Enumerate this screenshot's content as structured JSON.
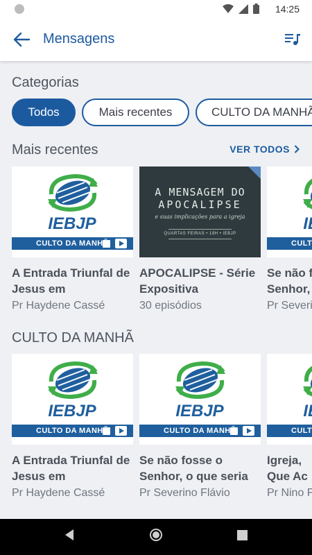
{
  "status_bar": {
    "time": "14:25"
  },
  "app_bar": {
    "title": "Mensagens"
  },
  "categories": {
    "title": "Categorias",
    "chips": [
      {
        "label": "Todos",
        "active": true
      },
      {
        "label": "Mais recentes",
        "active": false
      },
      {
        "label": "CULTO DA MANHÃ",
        "active": false
      }
    ]
  },
  "recent": {
    "title": "Mais recentes",
    "see_all": "VER TODOS",
    "cards": [
      {
        "title": "A Entrada Triunfal de Jesus em",
        "subtitle": "Pr Haydene Cassé",
        "band": "CULTO DA MANHÃ",
        "logo_text": "IEBJP"
      },
      {
        "title": "APOCALIPSE - Série Expositiva",
        "subtitle": "30 episódios",
        "image_line1": "A MENSAGEM DO",
        "image_line2": "APOCALIPSE",
        "image_line3": "e suas implicações para a igreja",
        "image_line4": "QUARTAS FEIRAS • 19H • IEBJP"
      },
      {
        "title": "Se não fosse o Senhor, o que seria",
        "subtitle": "Pr Severino Flávio",
        "band": "CULTO DA MANHÃ",
        "logo_text": "IEBJP"
      }
    ]
  },
  "culto": {
    "title": "CULTO DA MANHÃ",
    "cards": [
      {
        "title": "A Entrada Triunfal de Jesus em",
        "subtitle": "Pr Haydene Cassé",
        "band": "CULTO DA MANHÃ",
        "logo_text": "IEBJP"
      },
      {
        "title": "Se não fosse o Senhor, o que seria",
        "subtitle": "Pr Severino Flávio",
        "band": "CULTO DA MANHÃ",
        "logo_text": "IEBJP"
      },
      {
        "title": "Igreja, Que Ac",
        "subtitle": "Pr Nino F",
        "band": "CULTO DA MANHÃ",
        "logo_text": "IEBJP"
      }
    ]
  },
  "colors": {
    "accent": "#1c5aa0",
    "background": "#eef0f3",
    "logo_green": "#3fae49",
    "logo_blue": "#1f5f9e"
  },
  "icons": [
    "back-arrow-icon",
    "queue-music-icon",
    "chevron-right-icon",
    "wifi-icon",
    "signal-icon",
    "battery-icon"
  ]
}
